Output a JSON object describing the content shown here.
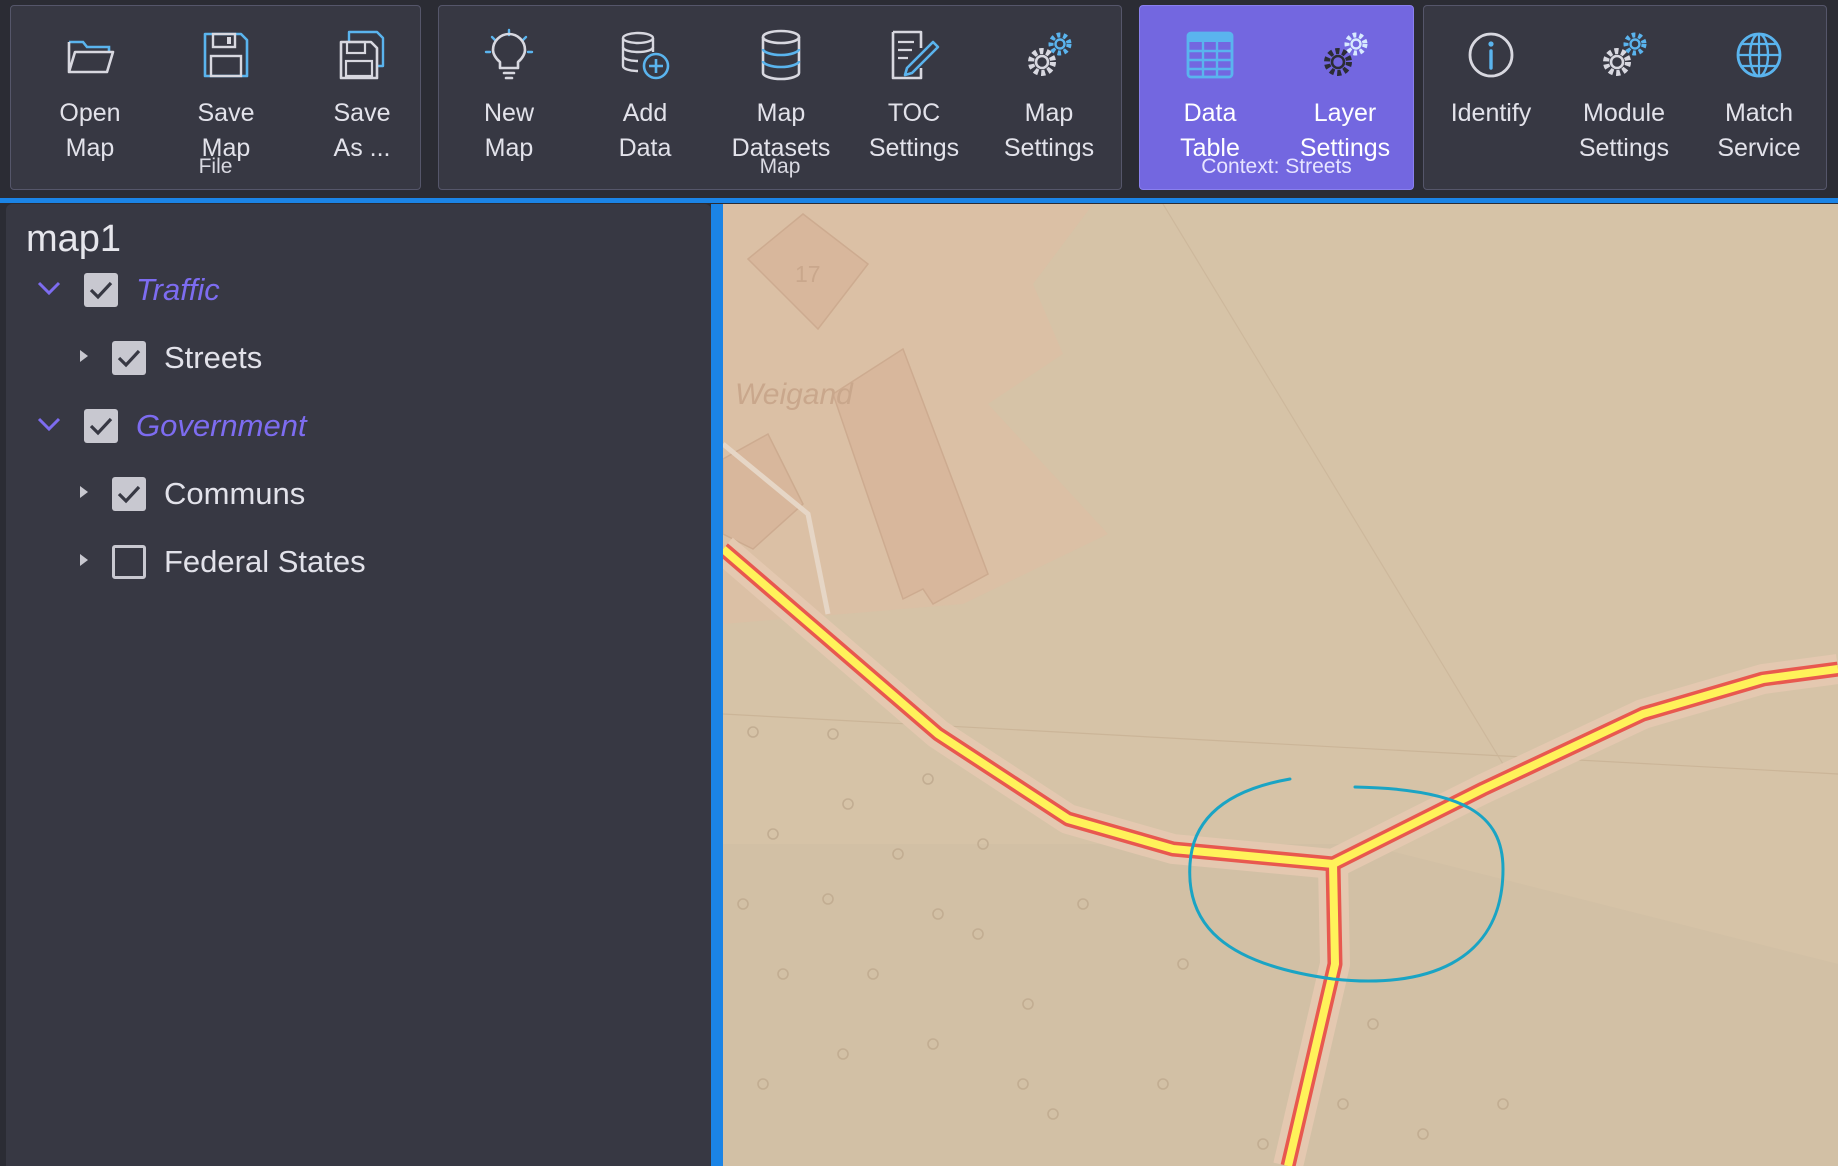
{
  "ribbon": {
    "groups": {
      "file": {
        "label": "File",
        "tools": {
          "open_map": "Open\nMap",
          "save_map": "Save\nMap",
          "save_as": "Save\nAs ..."
        }
      },
      "map": {
        "label": "Map",
        "tools": {
          "new_map": "New\nMap",
          "add_data": "Add\nData",
          "map_datasets": "Map\nDatasets",
          "toc_settings": "TOC\nSettings",
          "map_settings": "Map\nSettings"
        }
      },
      "context": {
        "label": "Context: Streets",
        "tools": {
          "data_table": "Data\nTable",
          "layer_settings": "Layer\nSettings"
        }
      },
      "tools": {
        "label": "",
        "tools": {
          "identify": "Identify",
          "module_settings": "Module\nSettings",
          "match_service": "Match\nService"
        }
      }
    }
  },
  "toc": {
    "title": "map1",
    "items": [
      {
        "label": "Traffic",
        "checked": true
      },
      {
        "label": "Streets",
        "checked": true
      },
      {
        "label": "Government",
        "checked": true
      },
      {
        "label": "Communs",
        "checked": true
      },
      {
        "label": "Federal States",
        "checked": false
      }
    ]
  },
  "map": {
    "labels": {
      "house_number": "17",
      "street_name": "Weigand"
    }
  },
  "colors": {
    "accent": "#7367e0",
    "selection_blue": "#1b84e6",
    "road_fill": "#fff25a",
    "road_casing": "#e8584f",
    "annotation_circle": "#1aa4c4",
    "map_background": "#d6c3a7"
  }
}
